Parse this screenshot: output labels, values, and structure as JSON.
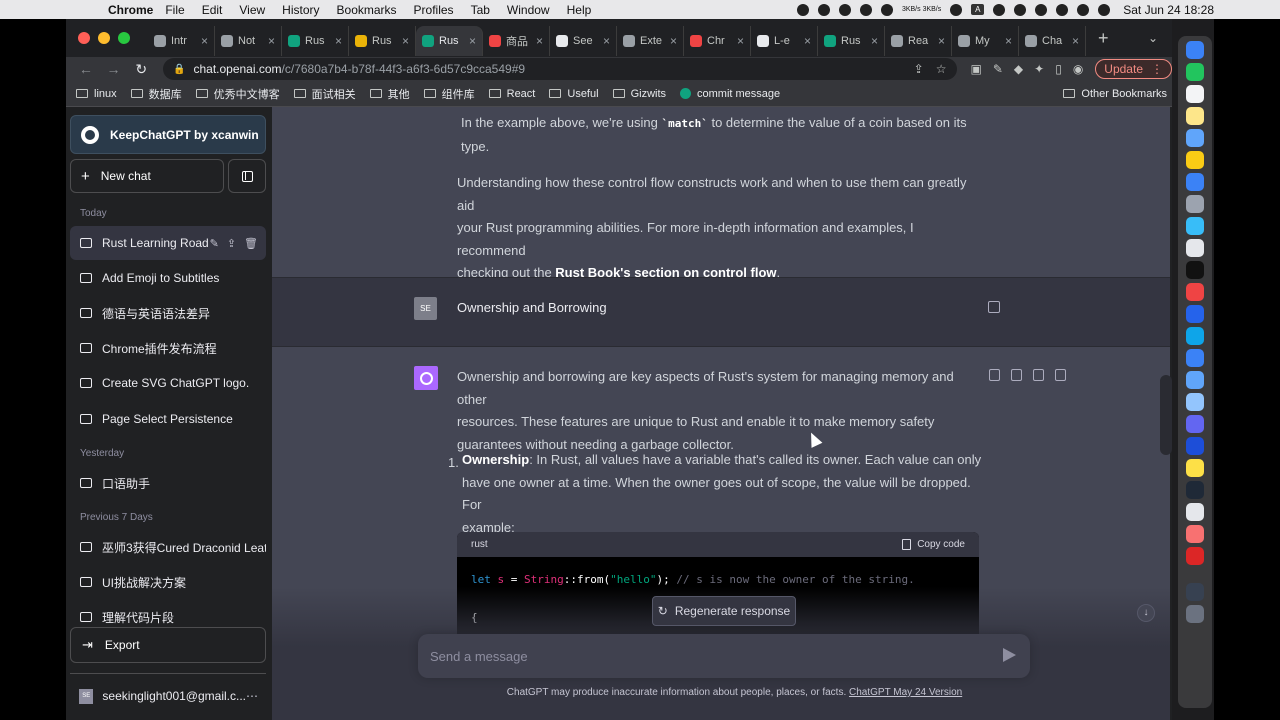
{
  "menubar": {
    "app_name": "Chrome",
    "items": [
      "File",
      "Edit",
      "View",
      "History",
      "Bookmarks",
      "Profiles",
      "Tab",
      "Window",
      "Help"
    ],
    "net_speed": "3KB/s\n3KB/s",
    "clock": "Sat Jun 24  18:28"
  },
  "browser": {
    "tabs": [
      {
        "label": "Intr"
      },
      {
        "label": "Not"
      },
      {
        "label": "Rus"
      },
      {
        "label": "Rus"
      },
      {
        "label": "Rus",
        "active": true
      },
      {
        "label": "商品"
      },
      {
        "label": "See"
      },
      {
        "label": "Exte"
      },
      {
        "label": "Chr"
      },
      {
        "label": "L-e"
      },
      {
        "label": "Rus"
      },
      {
        "label": "Rea"
      },
      {
        "label": "My"
      },
      {
        "label": "Cha"
      }
    ],
    "url_host": "chat.openai.com",
    "url_path": "/c/7680a7b4-b78f-44f3-a6f3-6d57c9cca549#9",
    "update_label": "Update",
    "bookmarks": [
      "linux",
      "数据库",
      "优秀中文博客",
      "面试相关",
      "其他",
      "组件库",
      "React",
      "Useful",
      "Gizwits"
    ],
    "bookmark_commit": "commit message",
    "other_bookmarks": "Other Bookmarks"
  },
  "sidebar": {
    "brand": "KeepChatGPT by xcanwin",
    "new_chat": "New chat",
    "groups": {
      "today": "Today",
      "yesterday": "Yesterday",
      "previous7": "Previous 7 Days"
    },
    "today": [
      "Rust Learning Road",
      "Add Emoji to Subtitles",
      "德语与英语语法差异",
      "Chrome插件发布流程",
      "Create SVG ChatGPT logo.",
      "Page Select Persistence"
    ],
    "yesterday": [
      "口语助手"
    ],
    "previous7": [
      "巫师3获得Cured Draconid Leath",
      "UI挑战解决方案",
      "理解代码片段"
    ],
    "export": "Export",
    "account_initials": "SE",
    "account_email": "seekinglight001@gmail.c..."
  },
  "conversation": {
    "prev_tail_1a": "In the example above, we're using ",
    "prev_tail_code": "`match`",
    "prev_tail_1b": " to determine the value of a coin based on its",
    "prev_tail_1c": "type.",
    "prev_para_2a": "Understanding how these control flow constructs work and when to use them can greatly aid",
    "prev_para_2b": "your Rust programming abilities. For more in-depth information and examples, I recommend",
    "prev_para_2c": "checking out the ",
    "prev_link": "Rust Book's section on control flow",
    "prev_para_2d": ".",
    "user_initials": "SE",
    "user_message": "Ownership and Borrowing",
    "answer_p1a": "Ownership and borrowing are key aspects of Rust's system for managing memory and other",
    "answer_p1b": "resources. These features are unique to Rust and enable it to make memory safety",
    "answer_p1c": "guarantees without needing a garbage collector.",
    "list_num": "1.",
    "list_title": "Ownership",
    "list_l1": ": In Rust, all values have a variable that's called its owner. Each value can only",
    "list_l2": "have one owner at a time. When the owner goes out of scope, the value will be dropped. For",
    "list_l3": "example:",
    "code_lang": "rust",
    "copy_code": "Copy code",
    "code_kw": "let",
    "code_var": "s",
    "code_eq": " = ",
    "code_type": "String",
    "code_sep": "::",
    "code_fn": "from(",
    "code_str": "\"hello\"",
    "code_end": "); ",
    "code_comment": "// s is now the owner of the string.",
    "code_brace": "{"
  },
  "composer": {
    "regenerate": "Regenerate response",
    "placeholder": "Send a message",
    "disclaimer": "ChatGPT may produce inaccurate information about people, places, or facts. ",
    "version_link": "ChatGPT May 24 Version"
  },
  "colors": {
    "accent_green": "#10a37f",
    "gpt_avatar": "#ab68ff",
    "update_red": "#f28b82"
  }
}
